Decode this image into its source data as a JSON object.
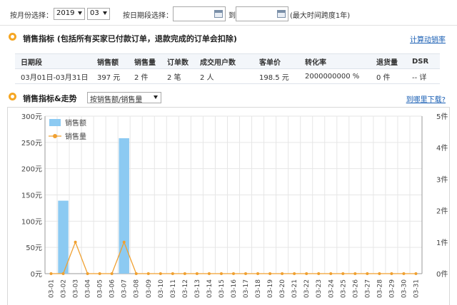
{
  "filter": {
    "month_label": "按月份选择：",
    "year_value": "2019",
    "month_value": "03",
    "range_label": "按日期段选择：",
    "to_label": "到",
    "range_note": "(最大时间跨度1年)"
  },
  "metrics": {
    "title": "销售指标",
    "note": "(包括所有买家已付款订单，退款完成的订单会扣除)",
    "link": "计算动销率",
    "columns": [
      "日期段",
      "销售额",
      "销售量",
      "订单数",
      "成交用户数",
      "客单价",
      "转化率",
      "退货量",
      "DSR"
    ],
    "row": [
      "03月01日-03月31日",
      "397 元",
      "2 件",
      "2 笔",
      "2 人",
      "198.5 元",
      "2000000000 %",
      "0 件",
      "-- 详"
    ]
  },
  "trend": {
    "title": "销售指标&走势",
    "mode_value": "按销售额/销售量",
    "link": "到哪里下载?"
  },
  "colors": {
    "bar": "#8ccaf2",
    "line": "#f0a030",
    "grid": "#e6e6e6",
    "axis_text": "#444444",
    "bullet": "#f5a623",
    "link": "#1a5fb4"
  },
  "chart_data": {
    "type": "bar",
    "categories": [
      "03-01",
      "03-02",
      "03-03",
      "03-04",
      "03-05",
      "03-06",
      "03-07",
      "03-08",
      "03-09",
      "03-10",
      "03-11",
      "03-12",
      "03-13",
      "03-14",
      "03-15",
      "03-16",
      "03-17",
      "03-18",
      "03-19",
      "03-20",
      "03-21",
      "03-22",
      "03-23",
      "03-24",
      "03-25",
      "03-26",
      "03-27",
      "03-28",
      "03-29",
      "03-30",
      "03-31"
    ],
    "series": [
      {
        "name": "销售额",
        "type": "bar",
        "axis": "left",
        "values": [
          0,
          139,
          0,
          0,
          0,
          0,
          258,
          0,
          0,
          0,
          0,
          0,
          0,
          0,
          0,
          0,
          0,
          0,
          0,
          0,
          0,
          0,
          0,
          0,
          0,
          0,
          0,
          0,
          0,
          0,
          0
        ]
      },
      {
        "name": "销售量",
        "type": "line",
        "axis": "right",
        "values": [
          0,
          0,
          1,
          0,
          0,
          0,
          1,
          0,
          0,
          0,
          0,
          0,
          0,
          0,
          0,
          0,
          0,
          0,
          0,
          0,
          0,
          0,
          0,
          0,
          0,
          0,
          0,
          0,
          0,
          0,
          0
        ]
      }
    ],
    "y_left": {
      "min": 0,
      "max": 300,
      "ticks": [
        "0元",
        "50元",
        "100元",
        "150元",
        "200元",
        "250元",
        "300元"
      ]
    },
    "y_right": {
      "min": 0,
      "max": 5,
      "ticks": [
        "0件",
        "1件",
        "2件",
        "3件",
        "4件",
        "5件"
      ]
    },
    "grid": true,
    "legend_position": "top-left"
  }
}
